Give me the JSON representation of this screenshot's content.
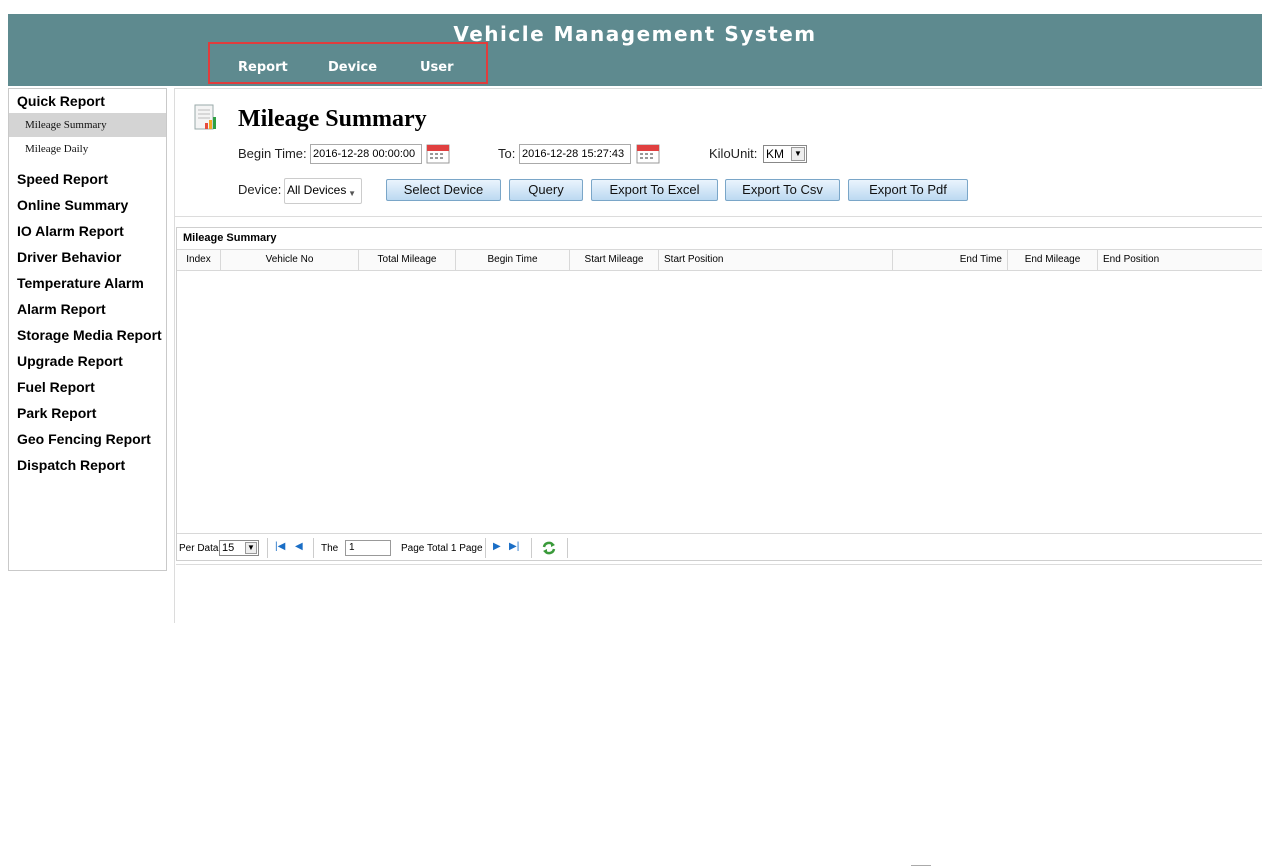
{
  "app": {
    "title": "Vehicle Management System"
  },
  "top_nav": {
    "items": [
      "Report",
      "Device",
      "User"
    ]
  },
  "sidebar": {
    "items": [
      {
        "label": "Quick Report",
        "type": "group"
      },
      {
        "label": "Mileage Summary",
        "type": "sub",
        "active": true
      },
      {
        "label": "Mileage Daily",
        "type": "sub"
      },
      {
        "label": "Speed Report",
        "type": "group"
      },
      {
        "label": "Online Summary",
        "type": "group"
      },
      {
        "label": "IO Alarm Report",
        "type": "group"
      },
      {
        "label": "Driver Behavior",
        "type": "group"
      },
      {
        "label": "Temperature Alarm",
        "type": "group"
      },
      {
        "label": "Alarm Report",
        "type": "group"
      },
      {
        "label": "Storage Media Report",
        "type": "group"
      },
      {
        "label": "Upgrade Report",
        "type": "group"
      },
      {
        "label": "Fuel Report",
        "type": "group"
      },
      {
        "label": "Park Report",
        "type": "group"
      },
      {
        "label": "Geo Fencing Report",
        "type": "group"
      },
      {
        "label": "Dispatch Report",
        "type": "group"
      }
    ]
  },
  "page": {
    "title": "Mileage Summary"
  },
  "filters": {
    "begin_label": "Begin Time:",
    "begin_value": "2016-12-28 00:00:00",
    "to_label": "To:",
    "to_value": "2016-12-28 15:27:43",
    "unit_label": "KiloUnit:",
    "unit_value": "KM",
    "device_label": "Device:",
    "device_value": "All Devices"
  },
  "buttons": {
    "select_device": "Select Device",
    "query": "Query",
    "export_excel": "Export To Excel",
    "export_csv": "Export To Csv",
    "export_pdf": "Export To Pdf"
  },
  "grid": {
    "caption": "Mileage Summary",
    "columns": [
      "Index",
      "Vehicle No",
      "Total Mileage",
      "Begin Time",
      "Start Mileage",
      "Start Position",
      "End Time",
      "End Mileage",
      "End Position"
    ]
  },
  "pager": {
    "per_data_label": "Per Data",
    "per_data_value": "15",
    "the_label": "The",
    "page_value": "1",
    "page_total": "Page  Total 1 Page"
  },
  "colors": {
    "header": "#5e8a8f",
    "highlight_box": "#e03c3c",
    "button_border": "#7aa6c8"
  }
}
